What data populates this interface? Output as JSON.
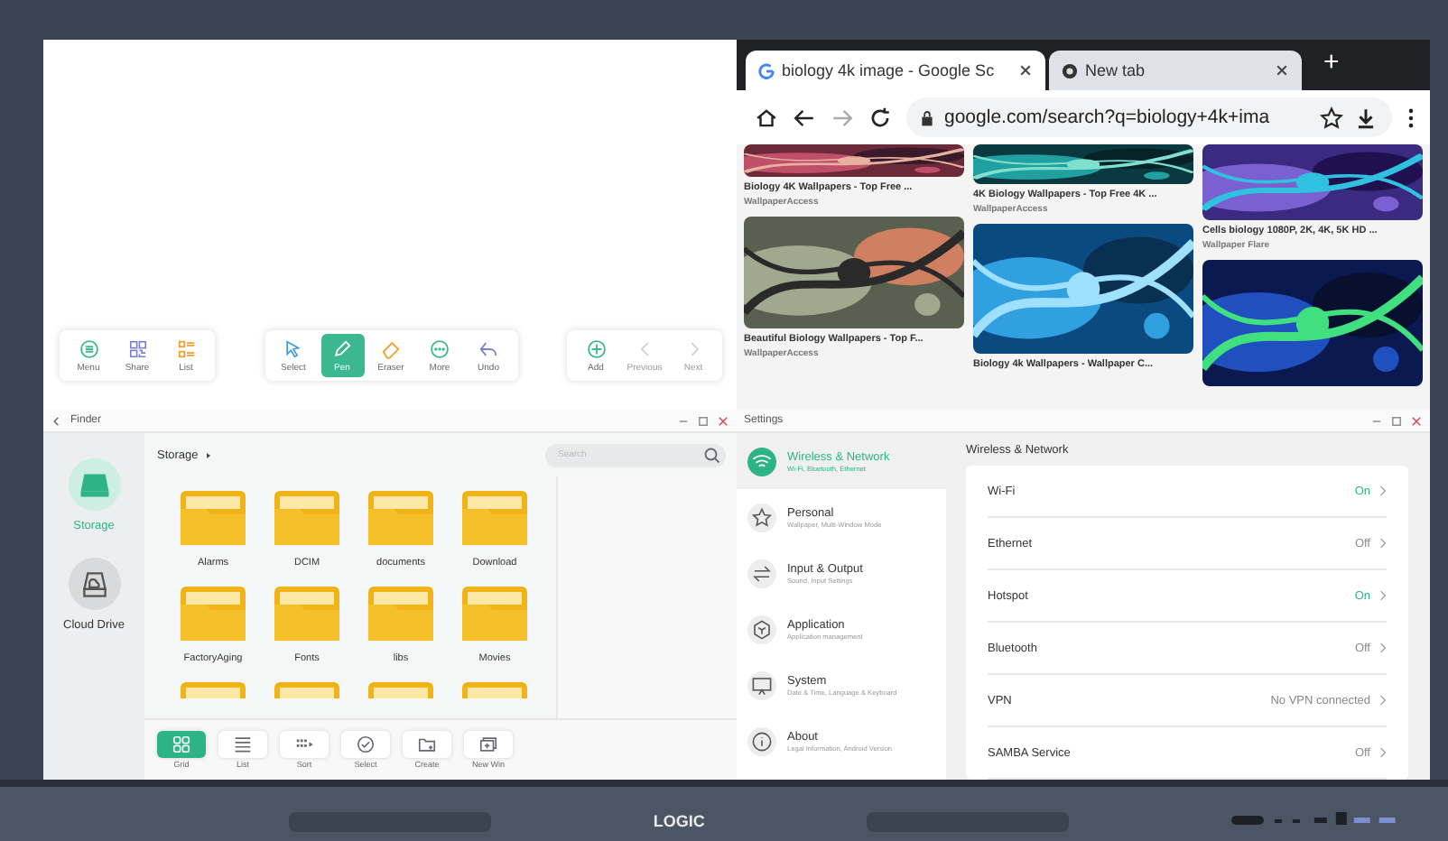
{
  "whiteboard": {
    "toolbar_groups": [
      [
        {
          "kind": "menu",
          "label": "Menu",
          "selected": false,
          "disabled": false
        },
        {
          "kind": "share",
          "label": "Share",
          "selected": false,
          "disabled": false
        },
        {
          "kind": "list",
          "label": "List",
          "selected": false,
          "disabled": false
        }
      ],
      [
        {
          "kind": "select",
          "label": "Select",
          "selected": false,
          "disabled": false
        },
        {
          "kind": "pen",
          "label": "Pen",
          "selected": true,
          "disabled": false
        },
        {
          "kind": "eraser",
          "label": "Eraser",
          "selected": false,
          "disabled": false
        },
        {
          "kind": "more",
          "label": "More",
          "selected": false,
          "disabled": false
        },
        {
          "kind": "undo",
          "label": "Undo",
          "selected": false,
          "disabled": false
        }
      ],
      [
        {
          "kind": "add",
          "label": "Add",
          "selected": false,
          "disabled": false
        },
        {
          "kind": "previous",
          "label": "Previous",
          "selected": false,
          "disabled": true
        },
        {
          "kind": "next",
          "label": "Next",
          "selected": false,
          "disabled": true
        }
      ]
    ]
  },
  "browser": {
    "tabs": [
      {
        "title": "biology 4k image - Google Sc",
        "selected": true
      },
      {
        "title": "New tab",
        "selected": false
      }
    ],
    "new_tab": "+",
    "url": "google.com/search?q=biology+4k+ima",
    "result_columns": [
      [
        {
          "kind": "picture",
          "title": "Biology 4K Wallpapers - Top Free ...",
          "source": "WallpaperAccess"
        },
        {
          "kind": "picture",
          "title": "Beautiful Biology Wallpapers - Top F...",
          "source": "WallpaperAccess"
        }
      ],
      [
        {
          "kind": "picture",
          "title": "4K Biology Wallpapers - Top Free 4K ...",
          "source": "WallpaperAccess"
        },
        {
          "kind": "picture",
          "title": "Biology 4k Wallpapers - Wallpaper C..."
        }
      ],
      [
        {
          "kind": "picture",
          "title": "Cells biology 1080P, 2K, 4K, 5K HD ...",
          "source": "Wallpaper Flare"
        },
        {
          "kind": "picture"
        }
      ]
    ]
  },
  "finder": {
    "title": "Finder",
    "sidebar": [
      {
        "kind": "storage",
        "label": "Storage",
        "selected": true
      },
      {
        "kind": "cloud",
        "label": "Cloud Drive",
        "selected": false
      }
    ],
    "breadcrumb": "Storage",
    "search": {
      "placeholder": "Search"
    },
    "folders": [
      {
        "name": "Alarms"
      },
      {
        "name": "DCIM"
      },
      {
        "name": "documents"
      },
      {
        "name": "Download"
      },
      {
        "name": "FactoryAging"
      },
      {
        "name": "Fonts"
      },
      {
        "name": "libs"
      },
      {
        "name": "Movies"
      },
      {
        "cut_off": true
      },
      {
        "cut_off": true
      },
      {
        "cut_off": true
      },
      {
        "cut_off": true
      }
    ],
    "toolbar": [
      {
        "kind": "grid",
        "label": "Grid",
        "selected": true
      },
      {
        "kind": "list",
        "label": "List",
        "selected": false
      },
      {
        "kind": "sort",
        "label": "Sort",
        "selected": false
      },
      {
        "kind": "select",
        "label": "Select",
        "selected": false
      },
      {
        "kind": "create",
        "label": "Create",
        "selected": false
      },
      {
        "kind": "newwin",
        "label": "New Win",
        "selected": false
      }
    ]
  },
  "settings": {
    "title": "Settings",
    "menu": [
      {
        "kind": "wifi",
        "title": "Wireless & Network",
        "subtitle": "Wi-Fi, Bluetooth, Ethernet",
        "selected": true
      },
      {
        "kind": "star",
        "title": "Personal",
        "subtitle": "Wallpaper, Multi-Window Mode",
        "selected": false
      },
      {
        "kind": "arrows",
        "title": "Input & Output",
        "subtitle": "Sound, Input Settings",
        "selected": false
      },
      {
        "kind": "app",
        "title": "Application",
        "subtitle": "Application management",
        "selected": false
      },
      {
        "kind": "screen",
        "title": "System",
        "subtitle": "Date & Time, Language & Keyboard",
        "selected": false
      },
      {
        "kind": "info",
        "title": "About",
        "subtitle": "Legal Information, Android Version",
        "selected": false
      }
    ],
    "heading": "Wireless & Network",
    "rows": [
      {
        "label": "Wi-Fi",
        "value": "On",
        "on": true
      },
      {
        "label": "Ethernet",
        "value": "Off",
        "on": false
      },
      {
        "label": "Hotspot",
        "value": "On",
        "on": true
      },
      {
        "label": "Bluetooth",
        "value": "Off",
        "on": false
      },
      {
        "label": "VPN",
        "value": "No VPN connected",
        "on": false
      },
      {
        "label": "SAMBA Service",
        "value": "Off",
        "on": false
      }
    ]
  },
  "bezel": {
    "logo": "LOGIC"
  }
}
